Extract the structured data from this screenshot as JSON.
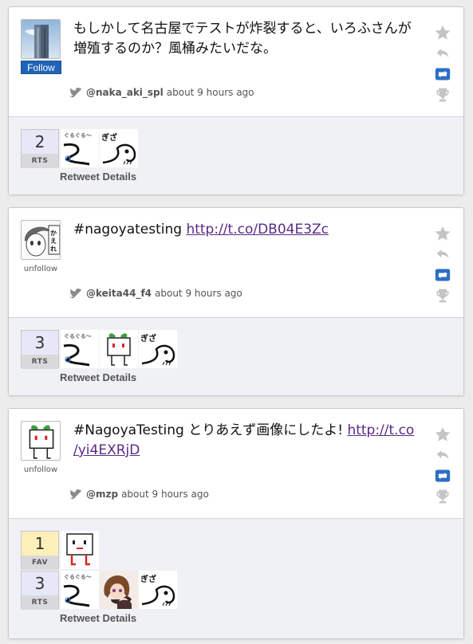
{
  "colors": {
    "follow": "#1f64b7",
    "link": "#5a2a86",
    "retweet_active": "#2b6fc4"
  },
  "tweets": [
    {
      "avatar_icon": "building-photo",
      "follow_label": "Follow",
      "text": "もしかして名古屋でテストが炸裂すると、いろふさんが増殖するのか？風桶みたいだな。",
      "username": "@naka_aki_spl",
      "time": "about 9 hours ago",
      "rt_count": "2",
      "rt_label": "RTS",
      "details": "Retweet Details"
    },
    {
      "avatar_icon": "manga-girl",
      "follow_label": "unfollow",
      "text_prefix": "#nagoyatesting ",
      "link": "http://t.co/DB04E3Zc",
      "username": "@keita44_f4",
      "time": "about 9 hours ago",
      "rt_count": "3",
      "rt_label": "RTS",
      "details": "Retweet Details"
    },
    {
      "avatar_icon": "sprout-robot",
      "follow_label": "unfollow",
      "text_prefix": "#NagoyaTesting とりあえず画像にしたよ! ",
      "link_line1": "http://t.co",
      "link_line2": "/yi4EXRjD",
      "username": "@mzp",
      "time": "about 9 hours ago",
      "fav_count": "1",
      "fav_label": "FAV",
      "rt_count": "3",
      "rt_label": "RTS",
      "details": "Retweet Details"
    }
  ]
}
